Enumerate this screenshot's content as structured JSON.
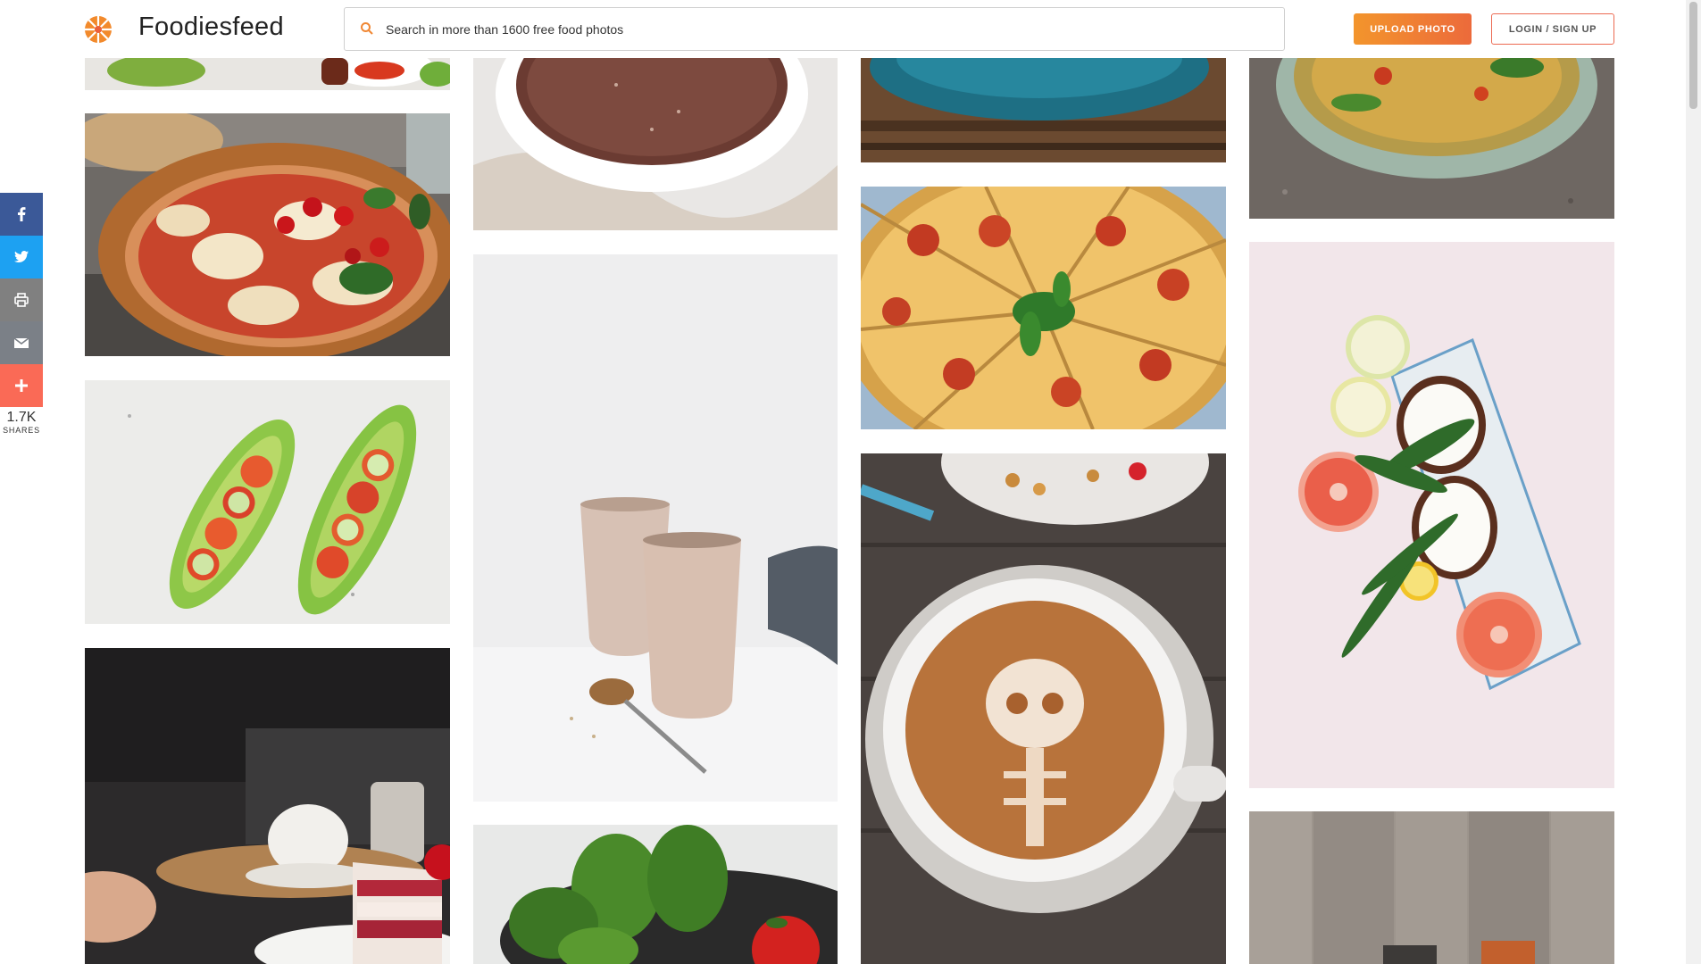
{
  "header": {
    "brand": "Foodiesfeed",
    "search_placeholder": "Search in more than 1600 free food photos",
    "upload_label": "UPLOAD PHOTO",
    "login_label": "LOGIN / SIGN UP"
  },
  "share": {
    "count": "1.7K",
    "label": "SHARES",
    "buttons": [
      "facebook-icon",
      "twitter-icon",
      "print-icon",
      "email-icon",
      "plus-icon"
    ]
  },
  "colors": {
    "accent_orange": "#f08734",
    "accent_red": "#ec6a3b",
    "facebook": "#3b5998",
    "twitter": "#1da1f2",
    "share_more": "#fa6a56"
  }
}
